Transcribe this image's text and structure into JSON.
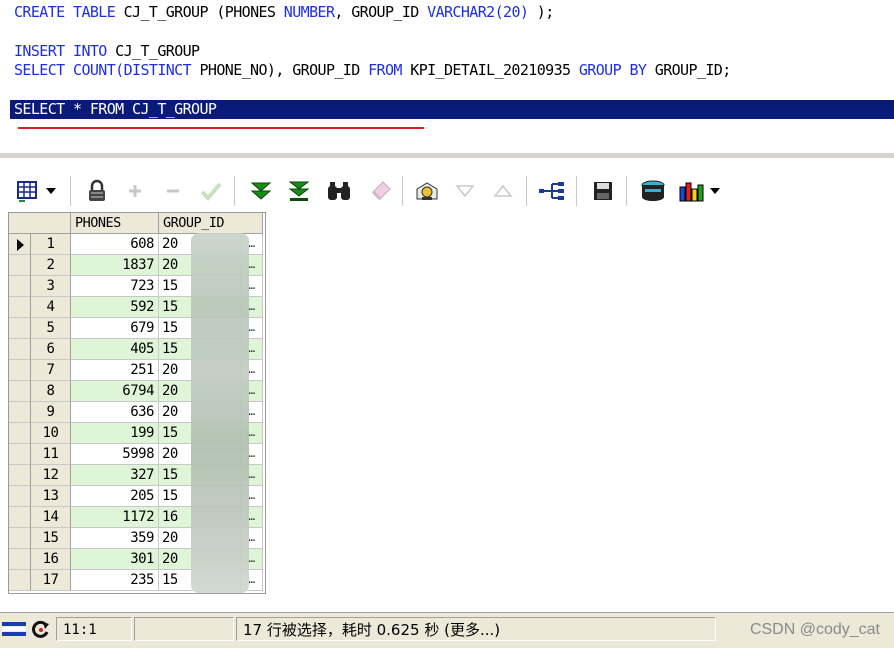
{
  "editor": {
    "line1": {
      "kw1": "CREATE TABLE",
      "t1": " CJ_T_GROUP (PHONES ",
      "kw2": "NUMBER",
      "t2": ", GROUP_ID ",
      "kw3": "VARCHAR2",
      "n1": "(20)",
      "t3": " );"
    },
    "line2": {
      "kw1": "INSERT INTO",
      "t1": " CJ_T_GROUP"
    },
    "line3": {
      "kw1": "SELECT COUNT(DISTINCT",
      "t1": " PHONE_NO), GROUP_ID ",
      "kw2": "FROM",
      "t2": " KPI_DETAIL_20210935 ",
      "kw3": "GROUP BY",
      "t3": " GROUP_ID;"
    },
    "line4": "SELECT * FROM CJ_T_GROUP"
  },
  "colors": {
    "selection": "#0a1a78",
    "keyword": "#1e2ee6",
    "underline": "#e02020",
    "alt_row": "#dff5d8"
  },
  "toolbar": {
    "icons": [
      "grid-options-icon",
      "dropdown-arrow-icon",
      "lock-icon",
      "add-record-icon",
      "delete-record-icon",
      "post-record-icon",
      "fetch-next-icon",
      "fetch-all-icon",
      "find-icon",
      "clear-icon",
      "query-by-example-icon",
      "filter-down-icon",
      "filter-up-icon",
      "link-icon",
      "save-icon",
      "export-icon",
      "chart-icon",
      "dropdown-arrow-icon"
    ]
  },
  "grid": {
    "columns": [
      "PHONES",
      "GROUP_ID"
    ],
    "current_row": 1,
    "button_label": "…",
    "rows": [
      {
        "n": "1",
        "phones": "608",
        "group": "20"
      },
      {
        "n": "2",
        "phones": "1837",
        "group": "20"
      },
      {
        "n": "3",
        "phones": "723",
        "group": "15"
      },
      {
        "n": "4",
        "phones": "592",
        "group": "15"
      },
      {
        "n": "5",
        "phones": "679",
        "group": "15"
      },
      {
        "n": "6",
        "phones": "405",
        "group": "15"
      },
      {
        "n": "7",
        "phones": "251",
        "group": "20"
      },
      {
        "n": "8",
        "phones": "6794",
        "group": "20"
      },
      {
        "n": "9",
        "phones": "636",
        "group": "20"
      },
      {
        "n": "10",
        "phones": "199",
        "group": "15"
      },
      {
        "n": "11",
        "phones": "5998",
        "group": "20"
      },
      {
        "n": "12",
        "phones": "327",
        "group": "15"
      },
      {
        "n": "13",
        "phones": "205",
        "group": "15"
      },
      {
        "n": "14",
        "phones": "1172",
        "group": "16"
      },
      {
        "n": "15",
        "phones": "359",
        "group": "20"
      },
      {
        "n": "16",
        "phones": "301",
        "group": "20"
      },
      {
        "n": "17",
        "phones": "235",
        "group": "15"
      }
    ]
  },
  "status": {
    "position": "11:1",
    "message": "17 行被选择，耗时 0.625 秒 (更多...)",
    "watermark": "CSDN @cody_cat"
  }
}
